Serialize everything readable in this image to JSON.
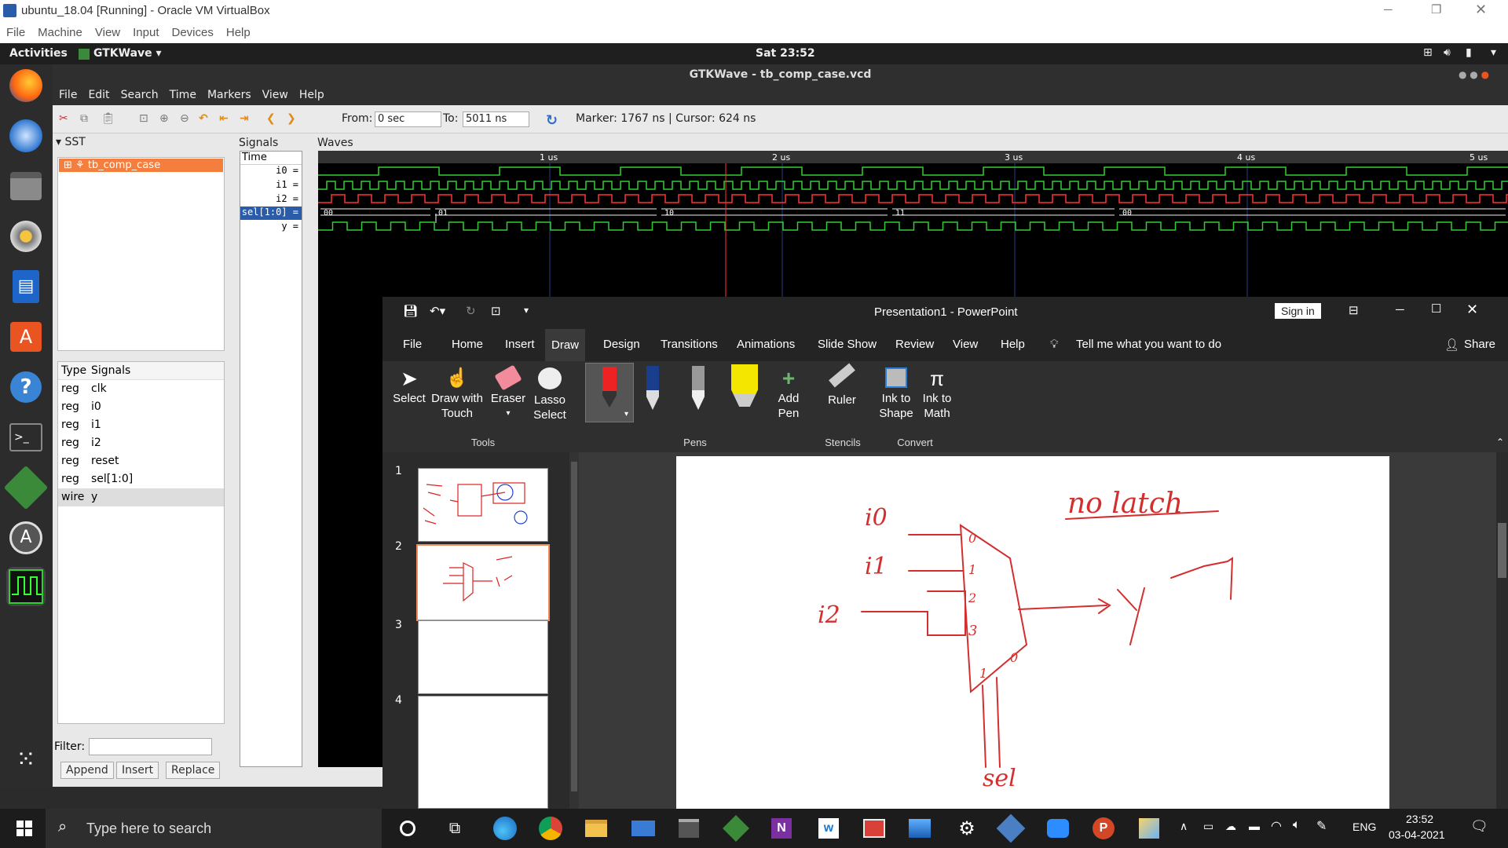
{
  "vbox": {
    "title": "ubuntu_18.04 [Running] - Oracle VM VirtualBox",
    "menu": [
      "File",
      "Machine",
      "View",
      "Input",
      "Devices",
      "Help"
    ]
  },
  "ubuntu": {
    "activities": "Activities",
    "app": "GTKWave ▾",
    "clock": "Sat 23:52"
  },
  "gtkwave": {
    "title": "GTKWave - tb_comp_case.vcd",
    "menu": [
      "File",
      "Edit",
      "Search",
      "Time",
      "Markers",
      "View",
      "Help"
    ],
    "from_label": "From:",
    "from_value": "0 sec",
    "to_label": "To:",
    "to_value": "5011 ns",
    "marker_text": "Marker: 1767 ns  |  Cursor: 624 ns",
    "sst_label": "SST",
    "signals_label": "Signals",
    "waves_label": "Waves",
    "tree_item": "tb_comp_case",
    "table_header": {
      "type": "Type",
      "signals": "Signals"
    },
    "table_rows": [
      [
        "reg",
        "clk"
      ],
      [
        "reg",
        "i0"
      ],
      [
        "reg",
        "i1"
      ],
      [
        "reg",
        "i2"
      ],
      [
        "reg",
        "reset"
      ],
      [
        "reg",
        "sel[1:0]"
      ],
      [
        "wire",
        "y"
      ]
    ],
    "filter_label": "Filter:",
    "buttons": [
      "Append",
      "Insert",
      "Replace"
    ],
    "signal_names": [
      "Time",
      "i0 =",
      "i1 =",
      "i2 =",
      "sel[1:0] =",
      "y ="
    ],
    "time_ticks": [
      "1 us",
      "2 us",
      "3 us",
      "4 us",
      "5 us"
    ],
    "bus_values": [
      "00",
      "01",
      "10",
      "11",
      "00"
    ]
  },
  "powerpoint": {
    "title": "Presentation1  -  PowerPoint",
    "signin": "Sign in",
    "tabs": [
      "File",
      "Home",
      "Insert",
      "Draw",
      "Design",
      "Transitions",
      "Animations",
      "Slide Show",
      "Review",
      "View",
      "Help"
    ],
    "tell_me": "Tell me what you want to do",
    "share": "Share",
    "tools": {
      "select": "Select",
      "draw_touch_1": "Draw with",
      "draw_touch_2": "Touch",
      "eraser": "Eraser",
      "lasso_1": "Lasso",
      "lasso_2": "Select",
      "add_pen_1": "Add",
      "add_pen_2": "Pen",
      "ruler": "Ruler",
      "ink_shape_1": "Ink to",
      "ink_shape_2": "Shape",
      "ink_math_1": "Ink to",
      "ink_math_2": "Math"
    },
    "groups": [
      "Tools",
      "Pens",
      "Stencils",
      "Convert"
    ],
    "slides": [
      "1",
      "2",
      "3",
      "4"
    ],
    "slide_ink": {
      "i0": "i0",
      "i1": "i1",
      "i2": "i2",
      "latch": "no latch",
      "y": "y",
      "sel": "sel",
      "p0": "0",
      "p1": "1",
      "p2": "2",
      "p3": "3"
    }
  },
  "taskbar": {
    "search_placeholder": "Type here to search",
    "lang": "ENG",
    "time": "23:52",
    "date": "03-04-2021"
  }
}
